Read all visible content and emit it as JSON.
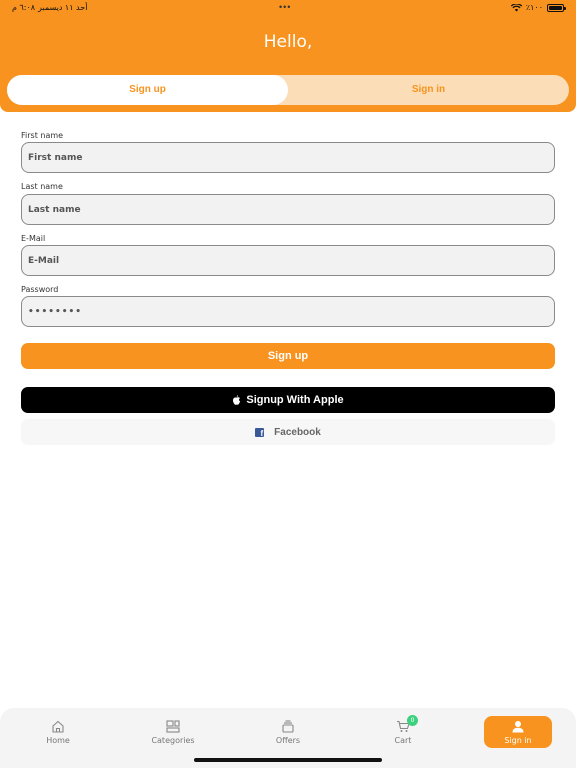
{
  "status_bar": {
    "time": "٦:٠٨ م",
    "date": "أحد ١١ ديسمبر",
    "dots": "•••",
    "battery_text": "٪١٠٠"
  },
  "header": {
    "greeting": "Hello,"
  },
  "auth_tabs": {
    "signup_label": "Sign up",
    "signin_label": "Sign in",
    "active": "signup"
  },
  "form": {
    "first_name": {
      "label": "First name",
      "placeholder": "First name",
      "value": ""
    },
    "last_name": {
      "label": "Last name",
      "placeholder": "Last name",
      "value": ""
    },
    "email": {
      "label": "E-Mail",
      "placeholder": "E-Mail",
      "value": ""
    },
    "password": {
      "label": "Password",
      "placeholder": "",
      "value": "********"
    }
  },
  "buttons": {
    "signup": "Sign up",
    "apple": "Signup With Apple",
    "facebook": "Facebook"
  },
  "tabbar": {
    "items": [
      {
        "label": "Home",
        "icon": "home-icon"
      },
      {
        "label": "Categories",
        "icon": "categories-icon"
      },
      {
        "label": "Offers",
        "icon": "offers-icon"
      },
      {
        "label": "Cart",
        "icon": "cart-icon",
        "badge": "0"
      },
      {
        "label": "Sign in",
        "icon": "user-icon",
        "active": true
      }
    ]
  },
  "colors": {
    "accent": "#F7931E",
    "segment_bg": "#FBDDB7",
    "badge": "#3DD17F",
    "facebook": "#3B5998"
  }
}
